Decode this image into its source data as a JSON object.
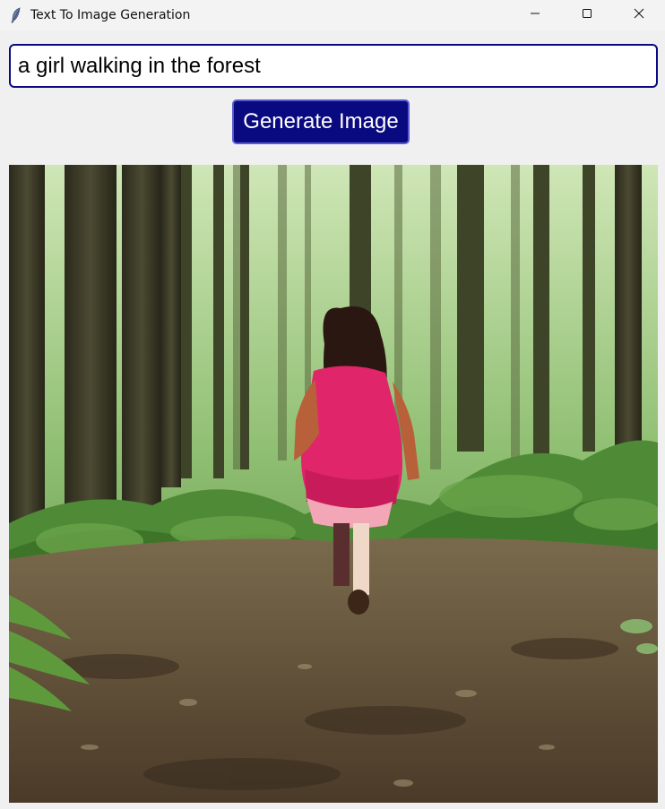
{
  "window": {
    "title": "Text To Image Generation",
    "controls": {
      "minimize_icon": "minimize-icon",
      "maximize_icon": "maximize-icon",
      "close_icon": "close-icon"
    },
    "app_icon": "feather-icon"
  },
  "prompt": {
    "value": "a girl walking in the forest"
  },
  "generate_button": {
    "label": "Generate Image"
  },
  "generated_image": {
    "alt": "a girl walking in the forest"
  },
  "colors": {
    "accent": "#0a0a80",
    "background": "#f0f0f0",
    "input_background": "#ffffff"
  }
}
